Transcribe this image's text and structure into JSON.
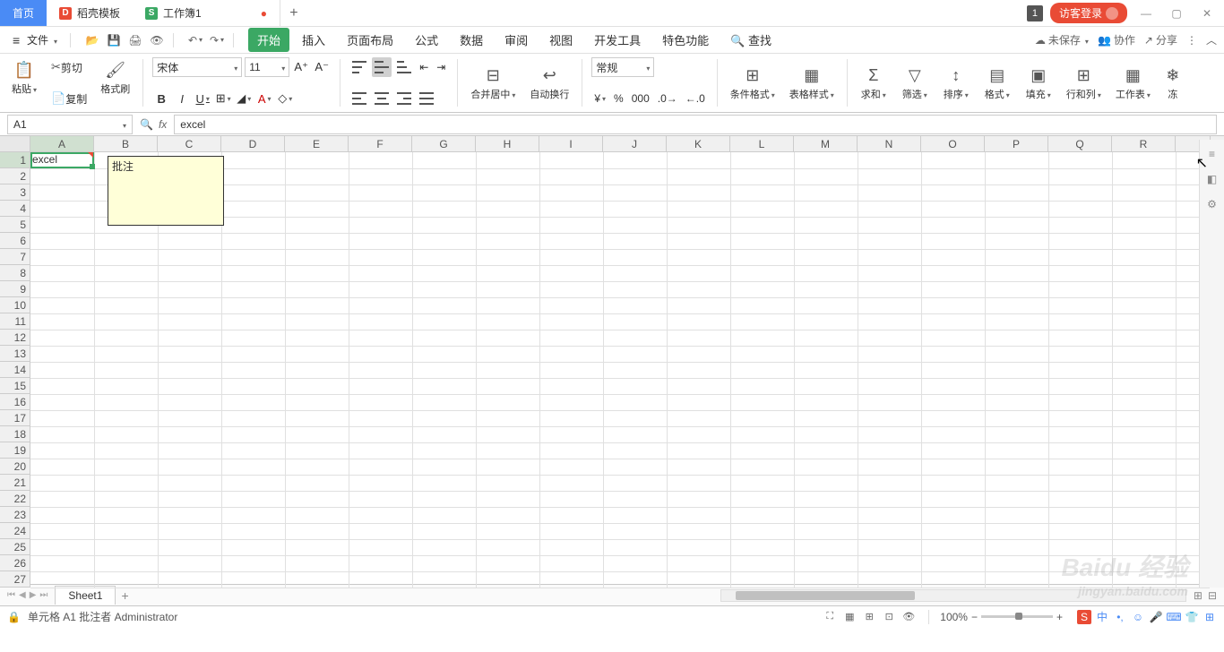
{
  "titlebar": {
    "home": "首页",
    "docer": "稻壳模板",
    "doc": "工作簿1",
    "badge": "1",
    "login": "访客登录"
  },
  "menubar": {
    "file": "文件",
    "tabs": [
      "开始",
      "插入",
      "页面布局",
      "公式",
      "数据",
      "审阅",
      "视图",
      "开发工具",
      "特色功能"
    ],
    "search": "查找",
    "unsaved": "未保存",
    "collab": "协作",
    "share": "分享"
  },
  "ribbon": {
    "paste": "粘贴",
    "cut": "剪切",
    "copy": "复制",
    "fmtpaint": "格式刷",
    "font": "宋体",
    "size": "11",
    "merge": "合并居中",
    "wrap": "自动换行",
    "numfmt": "常规",
    "condfmt": "条件格式",
    "tblstyle": "表格样式",
    "sum": "求和",
    "filter": "筛选",
    "sort": "排序",
    "format": "格式",
    "fill": "填充",
    "rowcol": "行和列",
    "sheet": "工作表",
    "freeze": "冻"
  },
  "formula": {
    "cellref": "A1",
    "value": "excel"
  },
  "grid": {
    "cols": [
      "A",
      "B",
      "C",
      "D",
      "E",
      "F",
      "G",
      "H",
      "I",
      "J",
      "K",
      "L",
      "M",
      "N",
      "O",
      "P",
      "Q",
      "R"
    ],
    "rows": 27,
    "a1": "excel",
    "comment": "批注"
  },
  "sheets": {
    "active": "Sheet1"
  },
  "status": {
    "text": "单元格 A1 批注者 Administrator",
    "zoom": "100%"
  },
  "watermark": {
    "main": "Baidu 经验",
    "sub": "jingyan.baidu.com"
  }
}
